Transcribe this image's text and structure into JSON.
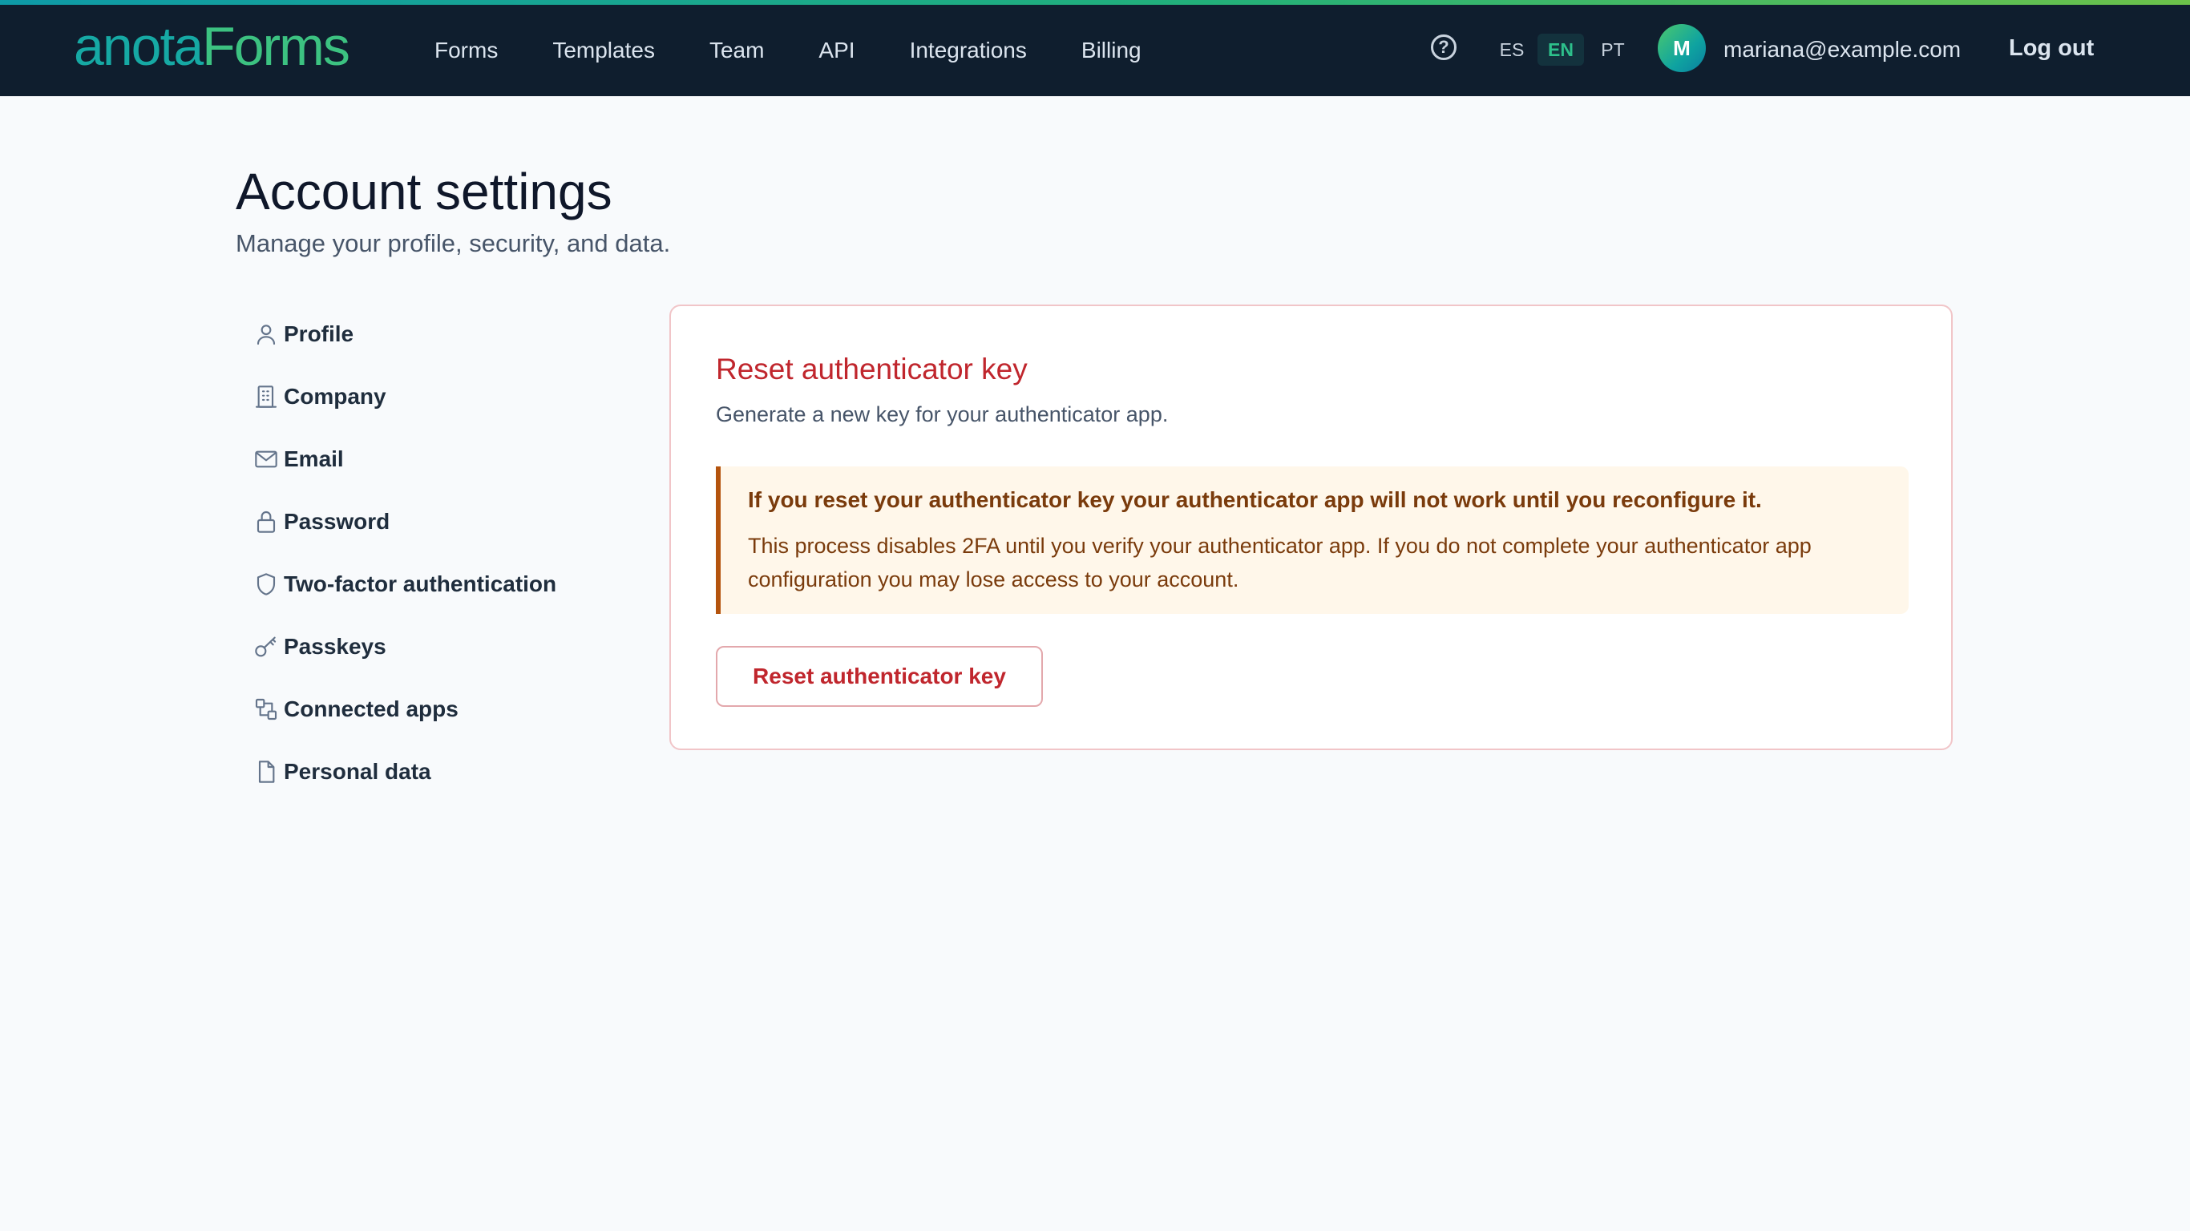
{
  "brand": {
    "part1": "anota",
    "part2": "Forms"
  },
  "nav": {
    "links": [
      "Forms",
      "Templates",
      "Team",
      "API",
      "Integrations",
      "Billing"
    ],
    "help_label": "?",
    "languages": [
      "ES",
      "EN",
      "PT"
    ],
    "active_language": "EN",
    "user": {
      "avatar_initial": "M",
      "email": "mariana@example.com"
    },
    "logout_label": "Log out"
  },
  "page": {
    "title": "Account settings",
    "subtitle": "Manage your profile, security, and data."
  },
  "sidebar": {
    "items": [
      {
        "label": "Profile",
        "icon": "user-icon"
      },
      {
        "label": "Company",
        "icon": "building-icon"
      },
      {
        "label": "Email",
        "icon": "mail-icon"
      },
      {
        "label": "Password",
        "icon": "lock-icon"
      },
      {
        "label": "Two-factor authentication",
        "icon": "shield-icon"
      },
      {
        "label": "Passkeys",
        "icon": "key-icon"
      },
      {
        "label": "Connected apps",
        "icon": "connected-apps-icon"
      },
      {
        "label": "Personal data",
        "icon": "document-icon"
      }
    ]
  },
  "card": {
    "title": "Reset authenticator key",
    "description": "Generate a new key for your authenticator app.",
    "warning_title": "If you reset your authenticator key your authenticator app will not work until you reconfigure it.",
    "warning_body": "This process disables 2FA until you verify your authenticator app. If you do not complete your authenticator app configuration you may lose access to your account.",
    "button_label": "Reset authenticator key"
  },
  "colors": {
    "navbar": "#0f1e2e",
    "danger": "#c0262d",
    "warning_bg": "#fff7ea",
    "warning_text": "#7a3b0c",
    "brand_teal": "#16a9a4",
    "brand_green": "#3cc281"
  }
}
